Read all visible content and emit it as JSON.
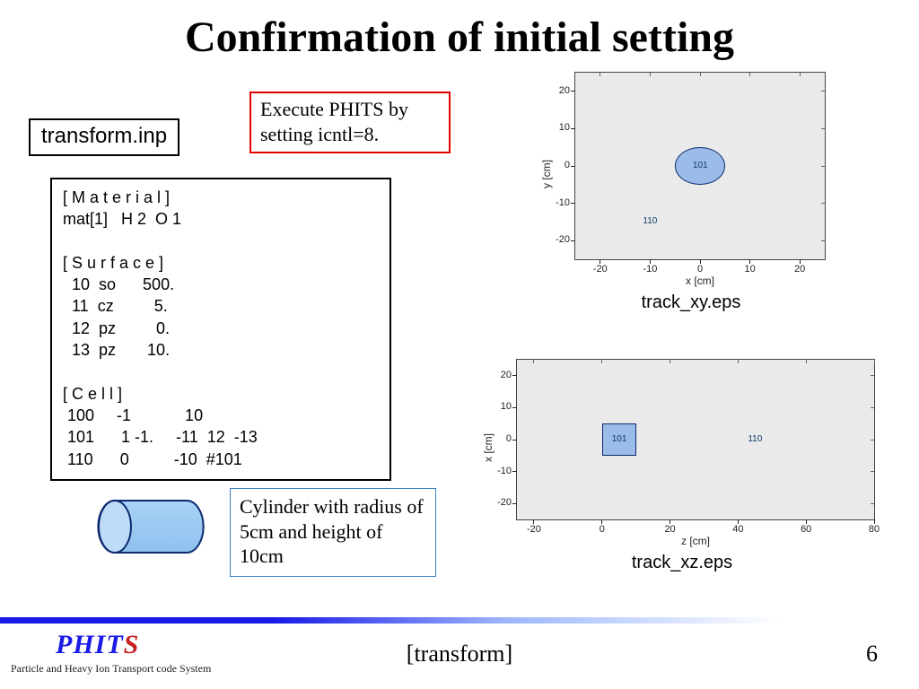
{
  "title": "Confirmation of initial setting",
  "filename": "transform.inp",
  "instruction": "Execute PHITS by setting icntl=8.",
  "code": "[ M a t e r i a l ]\nmat[1]   H 2  O 1\n\n[ S u r f a c e ]\n  10  so      500.\n  11  cz         5.\n  12  pz         0.\n  13  pz       10.\n\n[ C e l l ]\n 100     -1            10\n 101      1 -1.     -11  12  -13\n 110      0          -10  #101",
  "cylinder_desc": "Cylinder with radius of 5cm and height of 10cm",
  "footer": {
    "brand_prefix": "PHIT",
    "brand_s": "S",
    "subtitle": "Particle and Heavy Ion Transport code System",
    "center": "[transform]",
    "page": "6"
  },
  "chart_data": [
    {
      "type": "map",
      "caption": "track_xy.eps",
      "xlabel": "x [cm]",
      "ylabel": "y [cm]",
      "x_ticks": [
        -20,
        -10,
        0,
        10,
        20
      ],
      "y_ticks": [
        -20,
        -10,
        0,
        10,
        20
      ],
      "xlim": [
        -25,
        25
      ],
      "ylim": [
        -25,
        25
      ],
      "regions": [
        {
          "id": "101",
          "shape": "circle",
          "cx": 0,
          "cy": 0,
          "r": 5,
          "fill": "#9bbce8",
          "stroke": "#0a2a6e"
        },
        {
          "id": "110",
          "shape": "background",
          "label_x": -10,
          "label_y": -15
        }
      ]
    },
    {
      "type": "map",
      "caption": "track_xz.eps",
      "xlabel": "z [cm]",
      "ylabel": "x [cm]",
      "x_ticks": [
        -20,
        0,
        20,
        40,
        60,
        80
      ],
      "y_ticks": [
        -20,
        -10,
        0,
        10,
        20
      ],
      "xlim": [
        -25,
        80
      ],
      "ylim": [
        -25,
        25
      ],
      "regions": [
        {
          "id": "101",
          "shape": "rect",
          "x0": 0,
          "y0": -5,
          "x1": 10,
          "y1": 5,
          "fill": "#9bbce8",
          "stroke": "#0a2a6e"
        },
        {
          "id": "110",
          "shape": "background",
          "label_x": 45,
          "label_y": 0
        }
      ]
    }
  ]
}
